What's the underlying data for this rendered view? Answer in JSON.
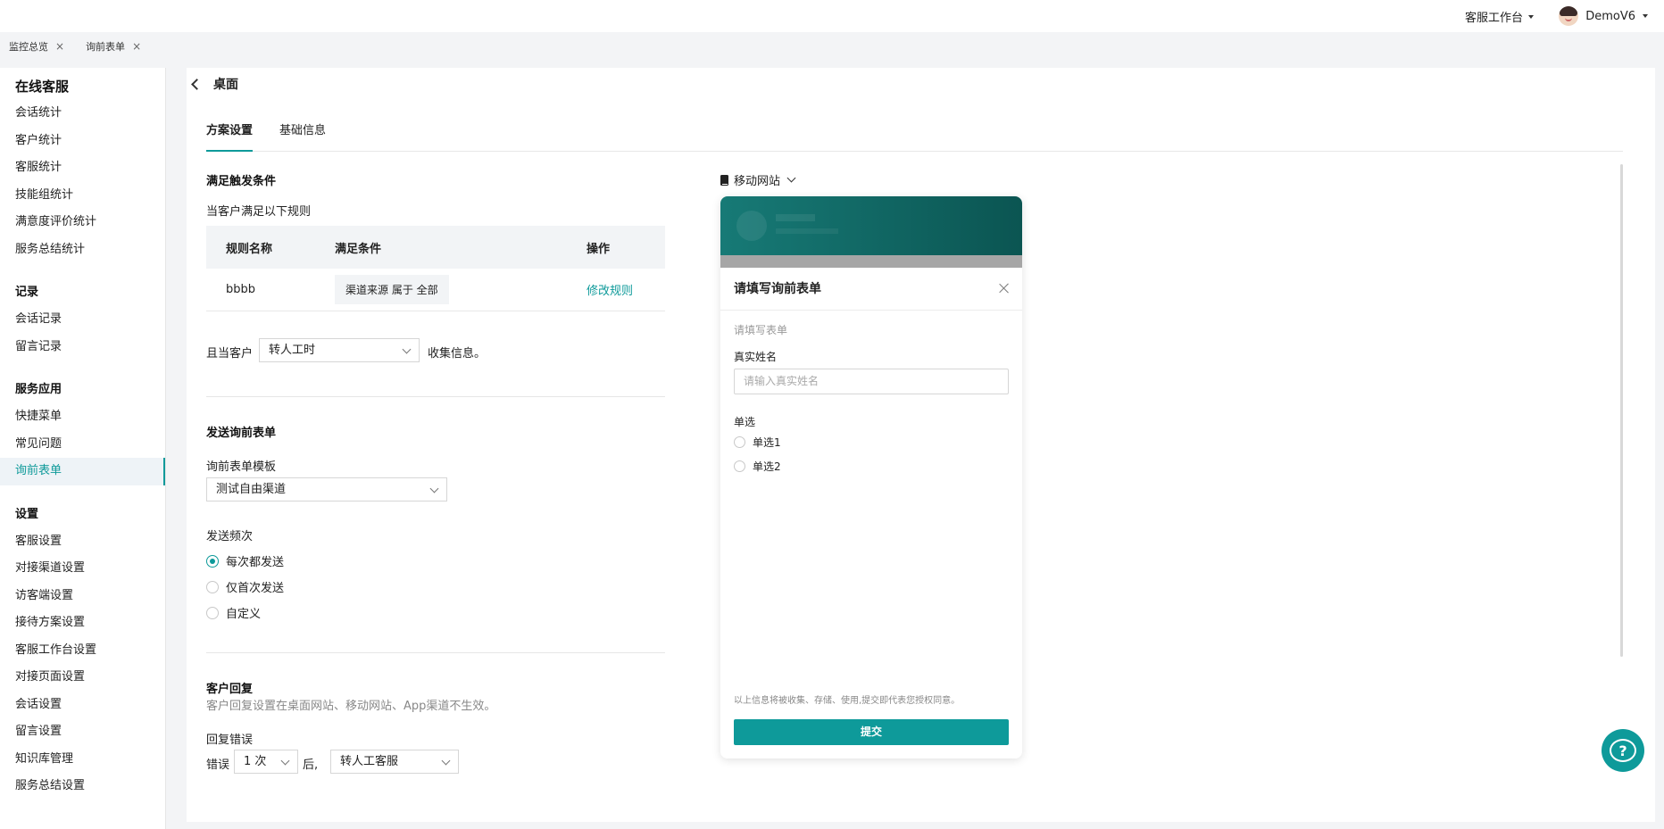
{
  "topbar": {
    "workspace_label": "客服工作台",
    "username": "DemoV6"
  },
  "page_tabs": [
    {
      "label": "监控总览"
    },
    {
      "label": "询前表单"
    }
  ],
  "sidebar": {
    "sections": [
      {
        "title": "在线客服",
        "items": [
          "会话统计",
          "客户统计",
          "客服统计",
          "技能组统计",
          "满意度评价统计",
          "服务总结统计"
        ]
      },
      {
        "title": "记录",
        "items": [
          "会话记录",
          "留言记录"
        ]
      },
      {
        "title": "服务应用",
        "items": [
          "快捷菜单",
          "常见问题",
          "询前表单"
        ]
      },
      {
        "title": "设置",
        "items": [
          "客服设置",
          "对接渠道设置",
          "访客端设置",
          "接待方案设置",
          "客服工作台设置",
          "对接页面设置",
          "会话设置",
          "留言设置",
          "知识库管理",
          "服务总结设置"
        ]
      }
    ],
    "active_item": "询前表单"
  },
  "header": {
    "title": "桌面"
  },
  "tabs": [
    {
      "label": "方案设置",
      "active": true
    },
    {
      "label": "基础信息",
      "active": false
    }
  ],
  "trigger": {
    "title": "满足触发条件",
    "subtitle": "当客户满足以下规则",
    "table": {
      "headers": [
        "规则名称",
        "满足条件",
        "操作"
      ],
      "rows": [
        {
          "name": "bbbb",
          "condition": "渠道来源 属于 全部",
          "action": "修改规则"
        }
      ]
    },
    "when_prefix": "且当客户",
    "when_select": "转人工时",
    "when_suffix": "收集信息。"
  },
  "send_form": {
    "title": "发送询前表单",
    "template_label": "询前表单模板",
    "template_value": "测试自由渠道",
    "frequency_label": "发送频次",
    "frequency_options": [
      "每次都发送",
      "仅首次发送",
      "自定义"
    ],
    "frequency_selected": 0
  },
  "reply": {
    "title": "客户回复",
    "note": "客户回复设置在桌面网站、移动网站、App渠道不生效。",
    "error_label": "回复错误",
    "error_prefix": "错误",
    "error_count": "1 次",
    "error_middle": "后,",
    "error_action": "转人工客服"
  },
  "preview": {
    "device": "移动网站",
    "form_title": "请填写询前表单",
    "form_subtitle": "请填写表单",
    "name_label": "真实姓名",
    "name_placeholder": "请输入真实姓名",
    "radio_label": "单选",
    "radio_options": [
      "单选1",
      "单选2"
    ],
    "consent_note": "以上信息将被收集、存储、使用,提交即代表您授权同意。",
    "submit_label": "提交"
  },
  "colors": {
    "accent": "#0e9a9a",
    "preview_header": "#0b5552"
  }
}
